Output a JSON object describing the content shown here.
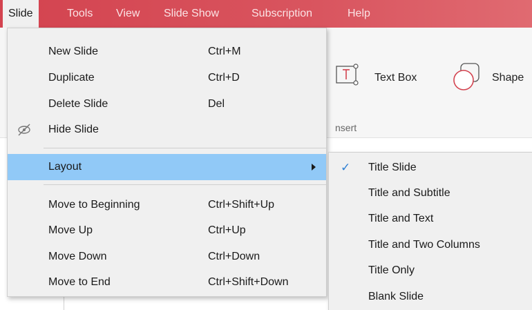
{
  "menubar": {
    "items": [
      {
        "label": "Slide"
      },
      {
        "label": "Tools"
      },
      {
        "label": "View"
      },
      {
        "label": "Slide Show"
      },
      {
        "label": "Subscription"
      },
      {
        "label": "Help"
      }
    ],
    "active_index": 0
  },
  "ribbon": {
    "text_box_label": "Text Box",
    "shape_label": "Shape",
    "insert_group_label": "nsert"
  },
  "slide_menu": {
    "items": [
      {
        "label": "New Slide",
        "shortcut": "Ctrl+M"
      },
      {
        "label": "Duplicate",
        "shortcut": "Ctrl+D"
      },
      {
        "label": "Delete Slide",
        "shortcut": "Del"
      },
      {
        "label": "Hide Slide",
        "shortcut": "",
        "icon": "hide-eye-icon"
      },
      {
        "label": "Layout",
        "shortcut": "",
        "has_submenu": true,
        "highlighted": true
      },
      {
        "label": "Move to Beginning",
        "shortcut": "Ctrl+Shift+Up"
      },
      {
        "label": "Move Up",
        "shortcut": "Ctrl+Up"
      },
      {
        "label": "Move Down",
        "shortcut": "Ctrl+Down"
      },
      {
        "label": "Move to End",
        "shortcut": "Ctrl+Shift+Down"
      }
    ]
  },
  "layout_submenu": {
    "items": [
      {
        "label": "Title Slide",
        "checked": true
      },
      {
        "label": "Title and Subtitle",
        "checked": false
      },
      {
        "label": "Title and Text",
        "checked": false
      },
      {
        "label": "Title and Two Columns",
        "checked": false
      },
      {
        "label": "Title Only",
        "checked": false
      },
      {
        "label": "Blank Slide",
        "checked": false
      }
    ]
  },
  "colors": {
    "menubar_bg": "#d9555f",
    "highlight": "#91c9f7",
    "check": "#2d7fd3",
    "accent_icon": "#d3434f"
  }
}
